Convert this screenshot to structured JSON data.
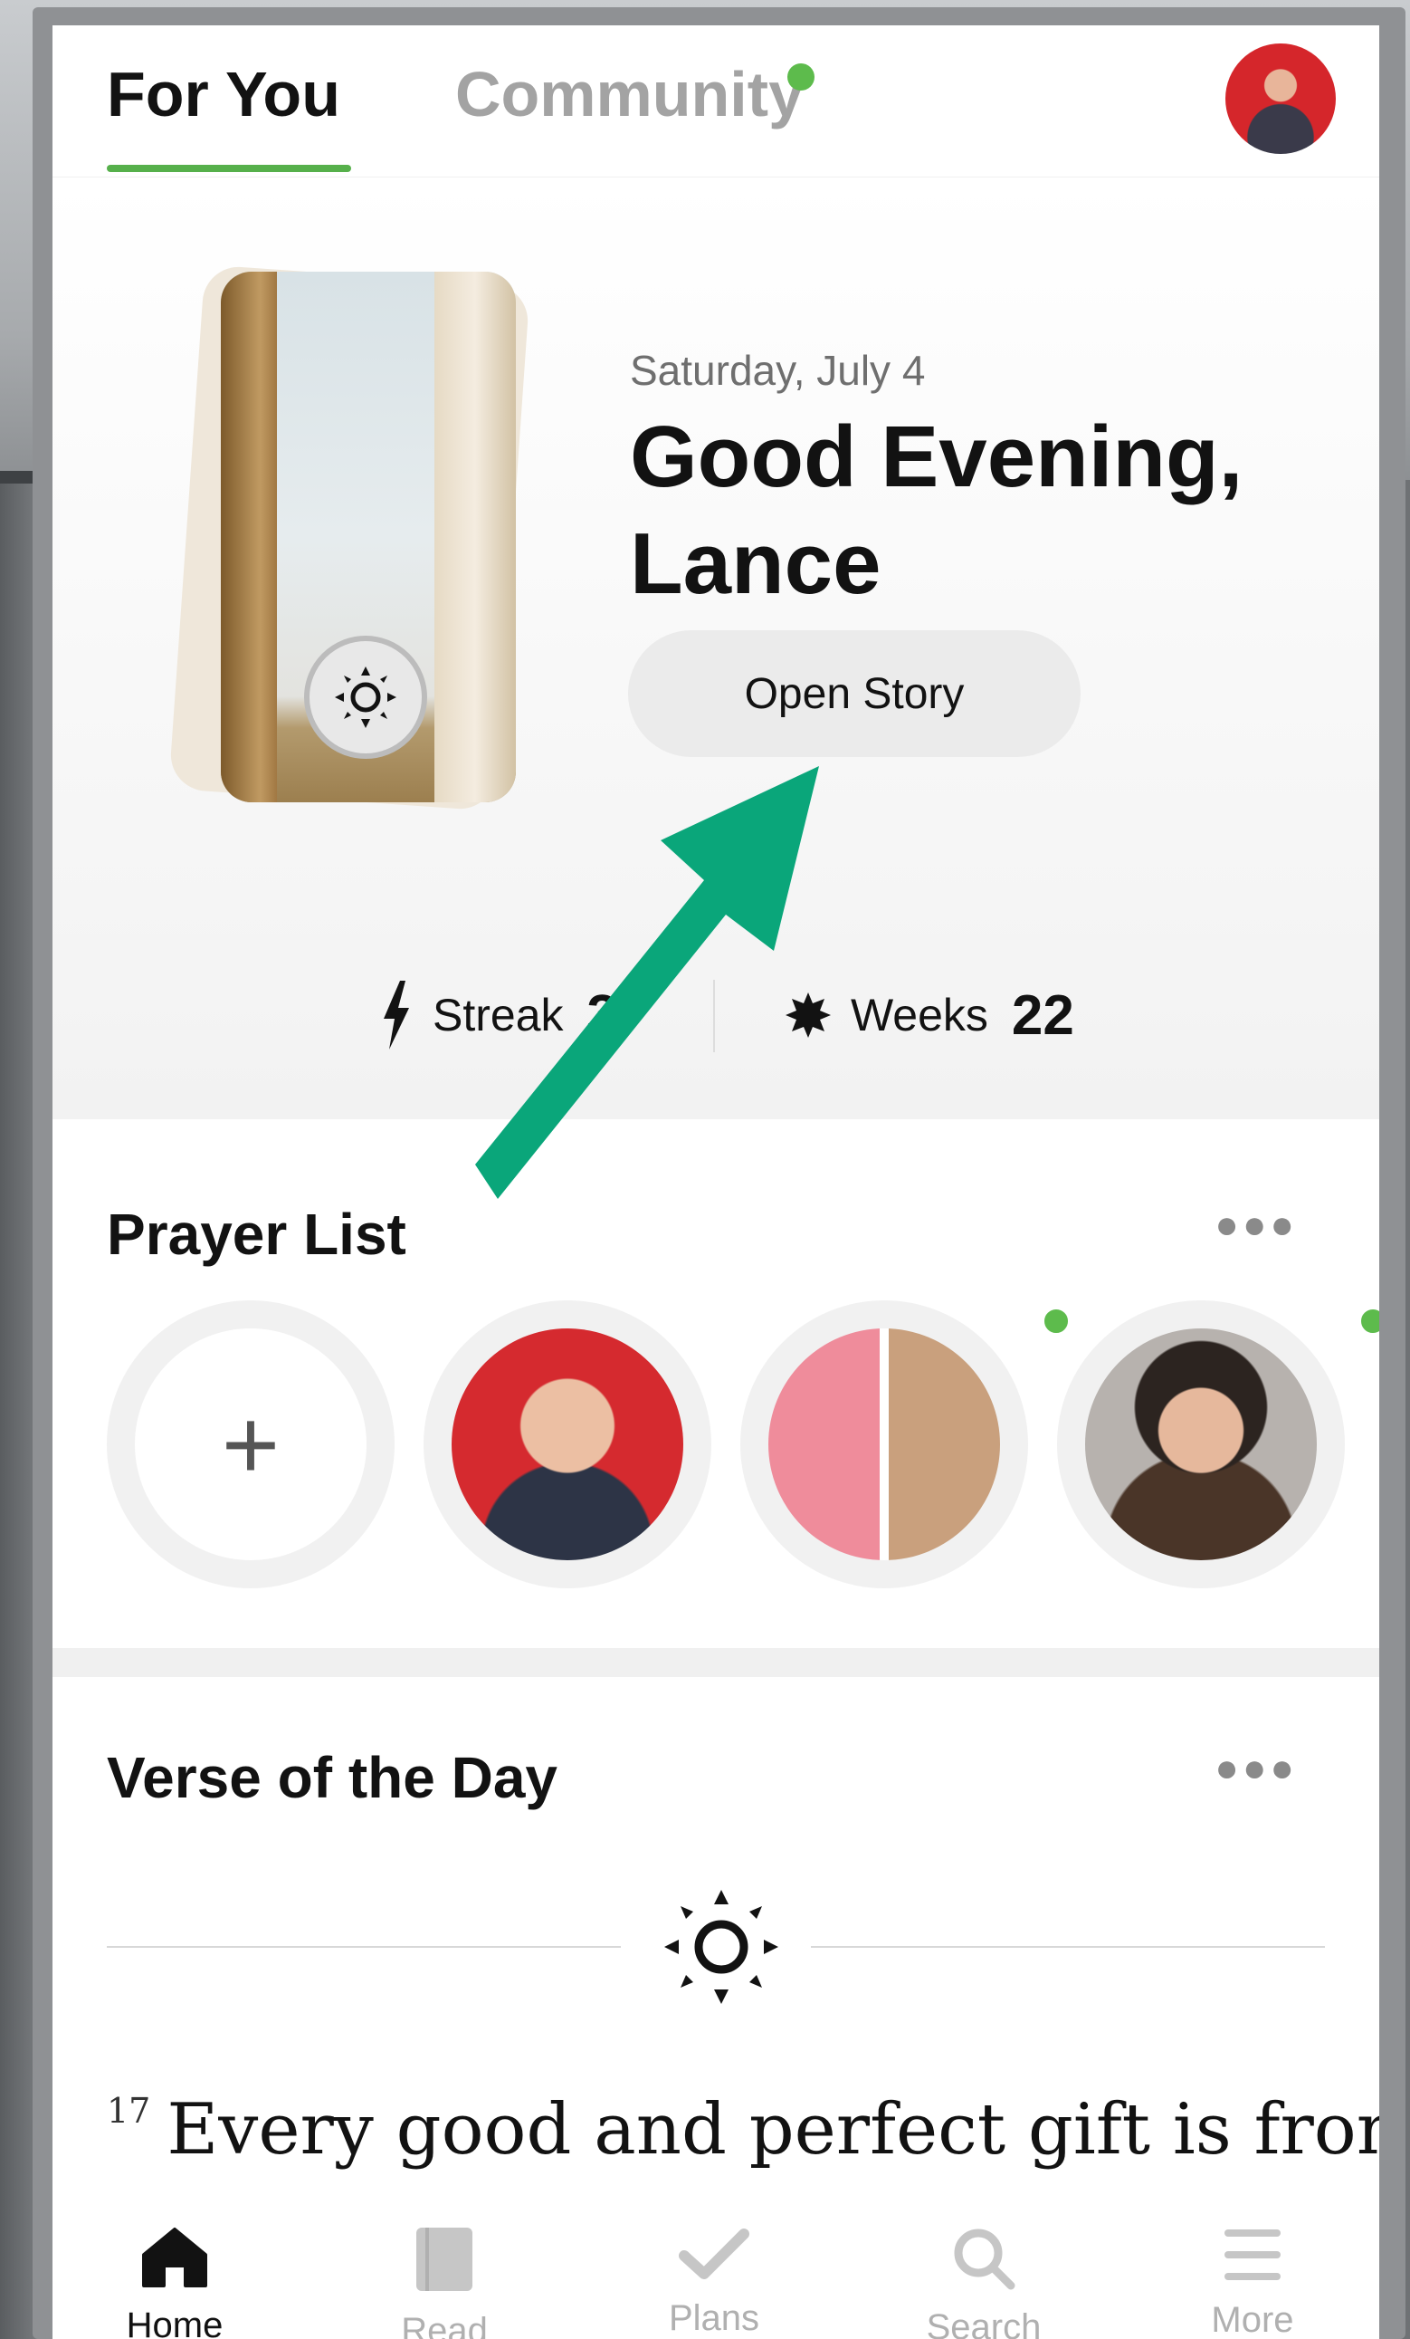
{
  "top_tabs": {
    "for_you": "For You",
    "community": "Community",
    "active": "For You",
    "accent": "#56b04b"
  },
  "greeting": {
    "date": "Saturday, July 4",
    "title": "Good Evening, Lance",
    "button": "Open Story",
    "card_icon": "sun-icon"
  },
  "stats": {
    "streak_label": "Streak",
    "streak_value": "3",
    "weeks_label": "Weeks",
    "weeks_value": "22"
  },
  "prayer_list": {
    "title": "Prayer List",
    "add_label": "+",
    "items_with_new": [
      2,
      3
    ]
  },
  "verse_of_day": {
    "title": "Verse of the Day",
    "verse_number": "17",
    "text": "Every good and perfect gift is from"
  },
  "bottom_nav": {
    "items": [
      {
        "label": "Home",
        "icon": "home-icon",
        "active": true
      },
      {
        "label": "Read",
        "icon": "book-icon",
        "active": false
      },
      {
        "label": "Plans",
        "icon": "checkmark-icon",
        "active": false
      },
      {
        "label": "Search",
        "icon": "search-icon",
        "active": false
      },
      {
        "label": "More",
        "icon": "menu-icon",
        "active": false
      }
    ]
  },
  "colors": {
    "status_dot": "#5dbb4c",
    "annotation_arrow": "#0aa67a"
  }
}
